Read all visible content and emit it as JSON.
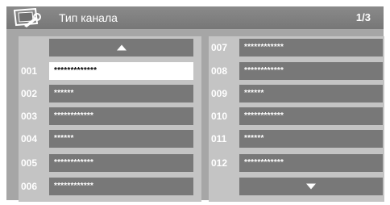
{
  "header": {
    "title": "Тип канала",
    "page": "1/3",
    "icon": "tv-wrench-icon"
  },
  "left_column": [
    {
      "num": "001",
      "name": "*************",
      "selected": true
    },
    {
      "num": "002",
      "name": "******",
      "selected": false
    },
    {
      "num": "003",
      "name": "************",
      "selected": false
    },
    {
      "num": "004",
      "name": "******",
      "selected": false
    },
    {
      "num": "005",
      "name": "************",
      "selected": false
    },
    {
      "num": "006",
      "name": "************",
      "selected": false
    }
  ],
  "right_column": [
    {
      "num": "007",
      "name": "************"
    },
    {
      "num": "008",
      "name": "************"
    },
    {
      "num": "009",
      "name": "******"
    },
    {
      "num": "010",
      "name": "************"
    },
    {
      "num": "011",
      "name": "******"
    },
    {
      "num": "012",
      "name": "************"
    }
  ],
  "nav": {
    "up_icon": "arrow-up-icon",
    "down_icon": "arrow-down-icon"
  },
  "colors": {
    "frame": "#a6a6a6",
    "header": "#808080",
    "panel": "#c4c4c4",
    "field": "#787878",
    "selected": "#ffffff"
  }
}
